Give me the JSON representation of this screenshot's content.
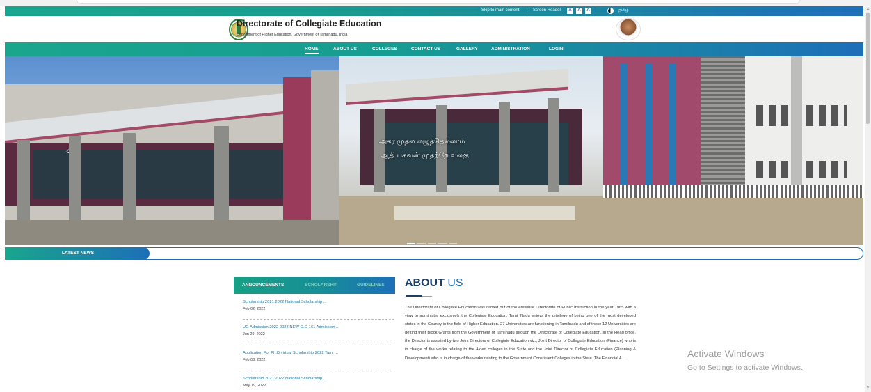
{
  "topbar": {
    "skip": "Skip to main content",
    "divider": "|",
    "screen_reader": "Screen Reader",
    "font_buttons": [
      "A",
      "A",
      "A"
    ],
    "language": "தமிழ்"
  },
  "header": {
    "title": "Directorate of Collegiate Education",
    "subtitle": "Department of Higher Education, Government of Tamilnadu, India"
  },
  "nav": {
    "items": [
      "HOME",
      "ABOUT US",
      "COLLEGES",
      "CONTACT US",
      "GALLERY",
      "ADMINISTRATION",
      "LOGIN"
    ]
  },
  "hero": {
    "line1": "அகர முதல எழுத்தெல்லாம்",
    "line2": "ஆதி பகவன் முதற்றே உலகு",
    "slide_count": 5,
    "active_slide": 0
  },
  "news": {
    "label": "LATEST NEWS"
  },
  "announcements": {
    "tabs": [
      "ANNOUNCEMENTS",
      "SCHOLARSHIP",
      "GUIDELINES"
    ],
    "items": [
      {
        "title": "Scholarship 2021 2022 National Scholarship ...",
        "date": "Feb 02, 2022"
      },
      {
        "title": "UG Admission 2022 2023 NEW G.O 161 Admission ...",
        "date": "Jun 29, 2022"
      },
      {
        "title": "Application For Ph.D virtual Scholarship 2022 Tami ...",
        "date": "Feb 03, 2022"
      },
      {
        "title": "Scholarship 2021 2022 National Scholarship ...",
        "date": "May 19, 2022"
      }
    ]
  },
  "about": {
    "heading_bold": "ABOUT",
    "heading_light": "US",
    "body": "The Directorate of Collegiate Education was carved out of the erstwhile Directorate of Public Instruction in the year 1965 with a view to administer exclusively the Collegiate Education. Tamil Nadu enjoys the privilege of being one of the most developed states in the Country in the field of Higher Education. 27 Universities are functioning in Tamilnadu and of these 12 Universities are getting their Block Grants from the Government of Tamilnadu through the Directorate of Collegiate Education. In the Head office, the Director is assisted by two Joint Directors of Collegiate Education viz., Joint Director of Collegiate Education (Finance) who is in charge of the works relating to the Aided colleges in the State and the Joint Director of Collegiate Education (Planning & Development) who is in charge of the works relating to the Government Constituent Colleges in the State. The Financial A..."
  },
  "watermark": {
    "title": "Activate Windows",
    "subtitle": "Go to Settings to activate Windows."
  },
  "colors": {
    "teal": "#19a68d",
    "blue": "#1d6fb8",
    "navy": "#1d3e66"
  }
}
